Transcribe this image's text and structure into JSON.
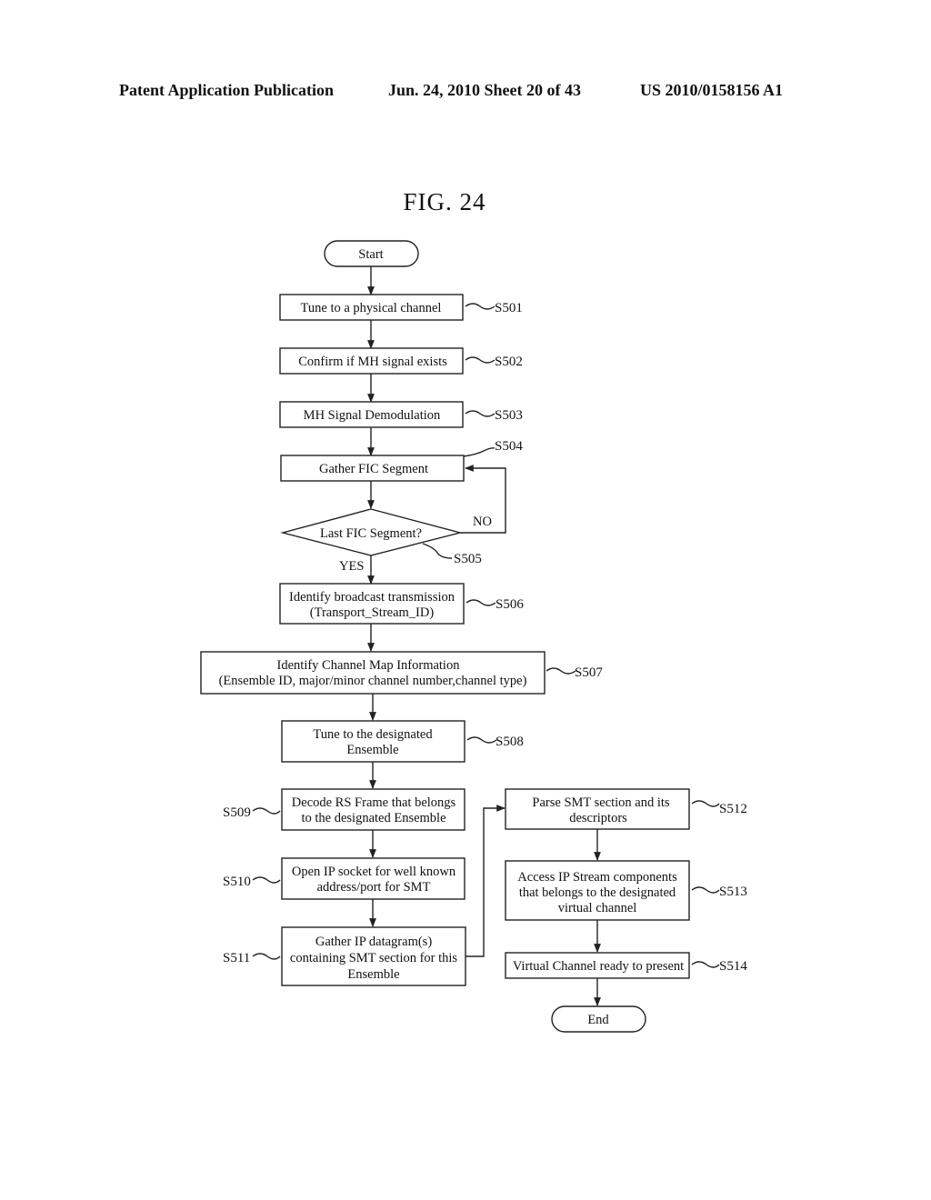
{
  "header": {
    "publication": "Patent Application Publication",
    "date_sheet": "Jun. 24, 2010  Sheet 20 of 43",
    "patent_number": "US 2010/0158156 A1"
  },
  "figure": {
    "title": "FIG. 24"
  },
  "flowchart": {
    "start": "Start",
    "end": "End",
    "steps": [
      {
        "id": "S501",
        "lines": [
          "Tune to a physical channel"
        ]
      },
      {
        "id": "S502",
        "lines": [
          "Confirm if MH signal exists"
        ]
      },
      {
        "id": "S503",
        "lines": [
          "MH Signal Demodulation"
        ]
      },
      {
        "id": "S504",
        "lines": [
          "Gather FIC Segment"
        ]
      },
      {
        "id": "S505",
        "lines": [
          "Last FIC Segment?"
        ]
      },
      {
        "id": "S506",
        "lines": [
          "Identify broadcast transmission",
          "(Transport_Stream_ID)"
        ]
      },
      {
        "id": "S507",
        "lines": [
          "Identify Channel Map Information",
          "(Ensemble ID, major/minor channel number,channel type)"
        ]
      },
      {
        "id": "S508",
        "lines": [
          "Tune to the designated",
          "Ensemble"
        ]
      },
      {
        "id": "S509",
        "lines": [
          "Decode RS Frame that belongs",
          "to the designated Ensemble"
        ]
      },
      {
        "id": "S510",
        "lines": [
          "Open IP socket for well known",
          "address/port for SMT"
        ]
      },
      {
        "id": "S511",
        "lines": [
          "Gather IP datagram(s)",
          "containing SMT section for this",
          "Ensemble"
        ]
      },
      {
        "id": "S512",
        "lines": [
          "Parse SMT section and its",
          "descriptors"
        ]
      },
      {
        "id": "S513",
        "lines": [
          "Access IP Stream components",
          "that belongs to the designated",
          "virtual channel"
        ]
      },
      {
        "id": "S514",
        "lines": [
          "Virtual Channel ready to present"
        ]
      }
    ],
    "decision_labels": {
      "yes": "YES",
      "no": "NO"
    }
  }
}
